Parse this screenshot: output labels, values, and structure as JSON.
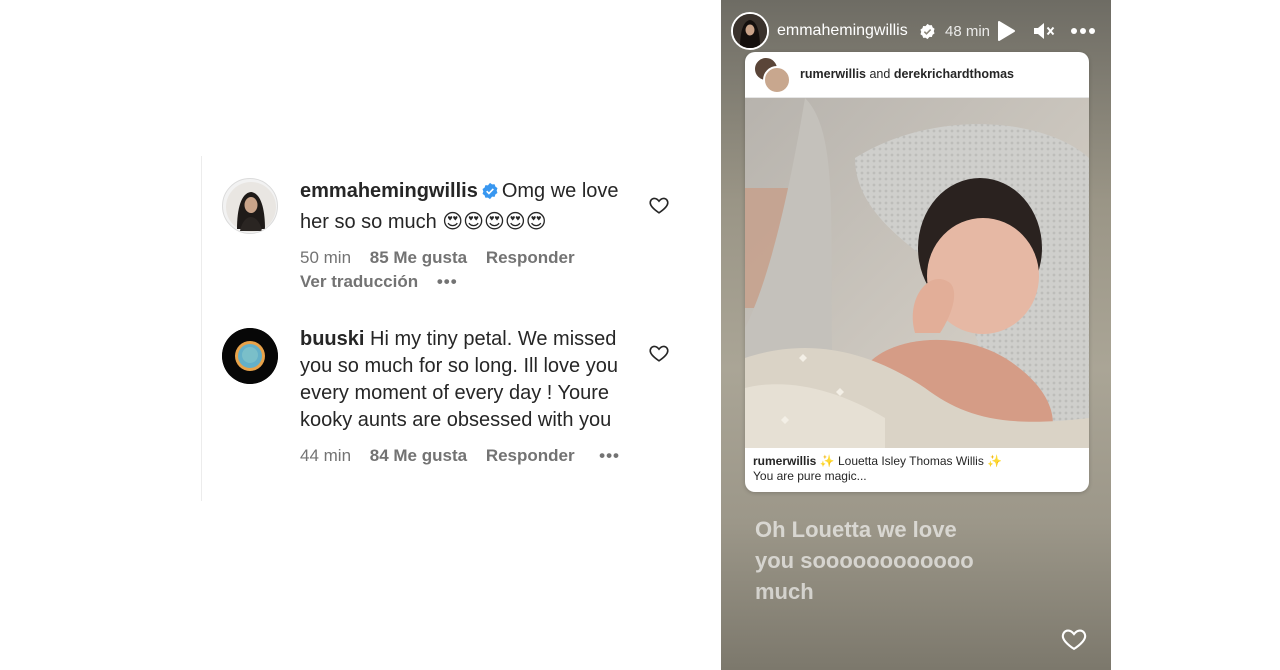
{
  "comments": [
    {
      "username": "emmahemingwillis",
      "verified": true,
      "text": "Omg we love her so so much",
      "emojis": "😍😍😍😍😍",
      "time": "50 min",
      "likes": "85 Me gusta",
      "reply_label": "Responder",
      "translate_label": "Ver traducción",
      "more": "•••"
    },
    {
      "username": "buuski",
      "verified": false,
      "text": "Hi my tiny petal. We missed you so much for so long. Ill love you every moment of every day ! Youre kooky aunts are obsessed with you",
      "time": "44 min",
      "likes": "84 Me gusta",
      "reply_label": "Responder",
      "more": "•••"
    }
  ],
  "story": {
    "username": "emmahemingwillis",
    "time": "48 min",
    "icons": [
      "verified-badge-icon",
      "play-icon",
      "mute-icon",
      "more-options-icon",
      "heart-icon"
    ],
    "shared_post": {
      "user_primary": "rumerwillis",
      "joiner": "and",
      "user_secondary": "derekrichardthomas",
      "caption_user": "rumerwillis",
      "caption_text": "✨ Louetta Isley Thomas Willis ✨",
      "caption_line2": "You are pure magic..."
    },
    "overlay_text": "Oh Louetta we love you soooooooooooo much"
  },
  "colors": {
    "verified_blue": "#3897f0",
    "meta_gray": "#737373",
    "text_dark": "#262626"
  }
}
